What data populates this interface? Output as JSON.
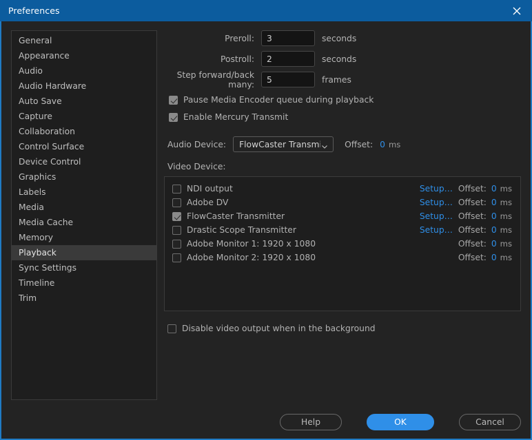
{
  "window": {
    "title": "Preferences",
    "close_icon": "close-icon",
    "accent_color": "#2f8fe8",
    "titlebar_color": "#0c5c9e",
    "border_color": "#1f7bc4"
  },
  "sidebar": {
    "items": [
      {
        "label": "General",
        "selected": false
      },
      {
        "label": "Appearance",
        "selected": false
      },
      {
        "label": "Audio",
        "selected": false
      },
      {
        "label": "Audio Hardware",
        "selected": false
      },
      {
        "label": "Auto Save",
        "selected": false
      },
      {
        "label": "Capture",
        "selected": false
      },
      {
        "label": "Collaboration",
        "selected": false
      },
      {
        "label": "Control Surface",
        "selected": false
      },
      {
        "label": "Device Control",
        "selected": false
      },
      {
        "label": "Graphics",
        "selected": false
      },
      {
        "label": "Labels",
        "selected": false
      },
      {
        "label": "Media",
        "selected": false
      },
      {
        "label": "Media Cache",
        "selected": false
      },
      {
        "label": "Memory",
        "selected": false
      },
      {
        "label": "Playback",
        "selected": true
      },
      {
        "label": "Sync Settings",
        "selected": false
      },
      {
        "label": "Timeline",
        "selected": false
      },
      {
        "label": "Trim",
        "selected": false
      }
    ]
  },
  "playback": {
    "fields": [
      {
        "label": "Preroll:",
        "value": "3",
        "unit": "seconds",
        "name": "preroll"
      },
      {
        "label": "Postroll:",
        "value": "2",
        "unit": "seconds",
        "name": "postroll"
      },
      {
        "label": "Step forward/back many:",
        "value": "5",
        "unit": "frames",
        "name": "step-frames"
      }
    ],
    "checkboxes": [
      {
        "label": "Pause Media Encoder queue during playback",
        "checked": true,
        "name": "pause-media-encoder"
      },
      {
        "label": "Enable Mercury Transmit",
        "checked": true,
        "name": "enable-mercury-transmit"
      }
    ],
    "audio_device": {
      "label": "Audio Device:",
      "selected": "FlowCaster Transmitter",
      "chevron_icon": "chevron-down-icon",
      "offset_label": "Offset:",
      "offset_value": "0",
      "offset_unit": "ms"
    },
    "video_device_label": "Video Device:",
    "video_devices": [
      {
        "name": "NDI output",
        "checked": false,
        "setup": "Setup…",
        "offset_label": "Offset:",
        "offset_value": "0",
        "offset_unit": "ms"
      },
      {
        "name": "Adobe DV",
        "checked": false,
        "setup": "Setup…",
        "offset_label": "Offset:",
        "offset_value": "0",
        "offset_unit": "ms"
      },
      {
        "name": "FlowCaster Transmitter",
        "checked": true,
        "setup": "Setup…",
        "offset_label": "Offset:",
        "offset_value": "0",
        "offset_unit": "ms"
      },
      {
        "name": "Drastic Scope Transmitter",
        "checked": false,
        "setup": "Setup…",
        "offset_label": "Offset:",
        "offset_value": "0",
        "offset_unit": "ms"
      },
      {
        "name": "Adobe Monitor 1: 1920 x 1080",
        "checked": false,
        "setup": "",
        "offset_label": "Offset:",
        "offset_value": "0",
        "offset_unit": "ms"
      },
      {
        "name": "Adobe Monitor 2: 1920 x 1080",
        "checked": false,
        "setup": "",
        "offset_label": "Offset:",
        "offset_value": "0",
        "offset_unit": "ms"
      }
    ],
    "disable_background": {
      "label": "Disable video output when in the background",
      "checked": false
    }
  },
  "footer": {
    "help_label": "Help",
    "ok_label": "OK",
    "cancel_label": "Cancel"
  }
}
